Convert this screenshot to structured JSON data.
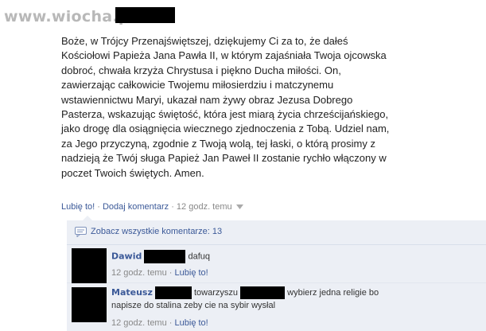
{
  "watermark": "www.wiocha.pl",
  "post": {
    "lines": [
      "Boże, w Trójcy Przenajświętszej, dziękujemy Ci za to, że dałeś",
      "Kościołowi Papieża Jana Pawła II, w którym zajaśniała Twoja ojcowska",
      "dobroć, chwała krzyża Chrystusa i piękno Ducha miłości. On,",
      "zawierzając całkowicie Twojemu miłosierdziu i matczynemu",
      "wstawiennictwu Maryi, ukazał nam żywy obraz Jezusa Dobrego",
      "Pasterza, wskazując świętość, która jest miarą życia chrześcijańskiego,",
      "jako drogę dla osiągnięcia wiecznego zjednoczenia z Tobą. Udziel nam,",
      "za Jego przyczyną, zgodnie z Twoją wolą, tej łaski, o którą prosimy z",
      "nadzieją że Twój sługa Papież Jan Paweł II zostanie rychło włączony w",
      "poczet Twoich świętych. Amen."
    ],
    "like_label": "Lubię to!",
    "separator": " · ",
    "comment_label": "Dodaj komentarz",
    "time": "12 godz. temu",
    "options_glyph": "·"
  },
  "comments": {
    "view_all_label": "Zobacz wszystkie komentarze: 13",
    "items": [
      {
        "name": "Dawid",
        "name_tail": "",
        "text": "dafuq",
        "time": "12 godz. temu",
        "like_label": "Lubię to!"
      },
      {
        "name": "Mateusz",
        "text_part1": "towarzyszu",
        "text_part2": "wybierz jedna religie bo",
        "text_line2": "napisze do stalina zeby cie na sybir wysłal",
        "time": "12 godz. temu",
        "like_label": "Lubię to!"
      }
    ]
  },
  "colors": {
    "link": "#3b5998",
    "comment_bg": "#eceff5",
    "meta": "#888888",
    "watermark": "#b8b8b8"
  }
}
